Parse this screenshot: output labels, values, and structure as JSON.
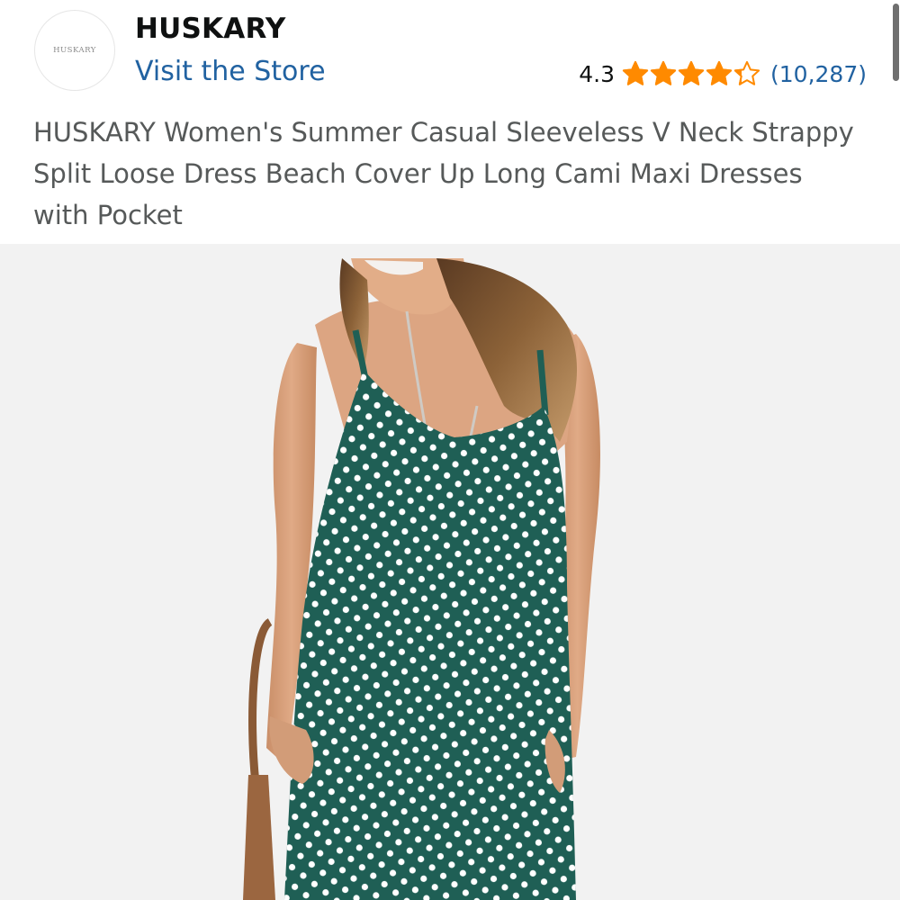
{
  "brand": {
    "logo_text": "HUSKARY",
    "name": "HUSKARY",
    "visit_store_label": "Visit the Store"
  },
  "rating": {
    "value": "4.3",
    "stars_filled": 4.3,
    "stars_total": 5,
    "star_color": "#ff8a00",
    "review_count": "(10,287)"
  },
  "product": {
    "title": "HUSKARY Women's Summer Casual Sleeveless V Neck Strappy Split Loose Dress Beach Cover Up Long Cami Maxi Dresses with Pocket",
    "dress_color": "#1f5f55",
    "dot_color": "#ffffff"
  },
  "colors": {
    "link": "#2162a1",
    "text_primary": "#0f1111",
    "text_secondary": "#565959",
    "image_background": "#f2f2f2"
  }
}
